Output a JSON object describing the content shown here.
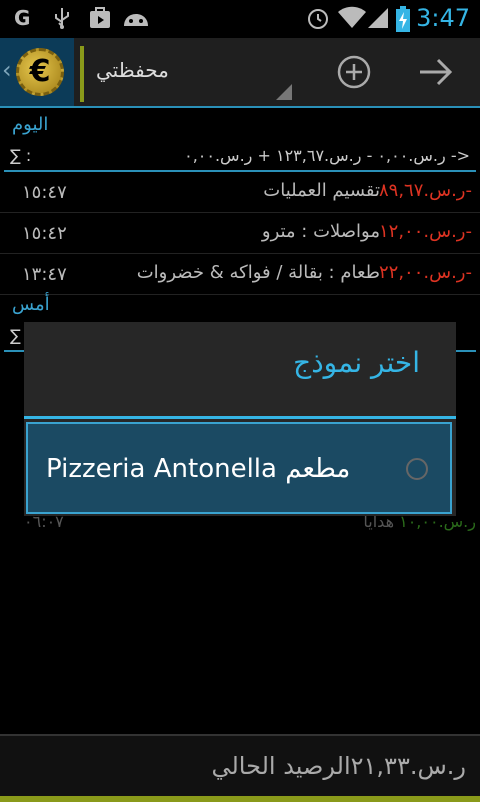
{
  "status_bar": {
    "time": "3:47",
    "icons": [
      "g-icon",
      "usb-icon",
      "play-store-icon",
      "android-icon",
      "alarm-icon",
      "wifi-icon",
      "signal-icon",
      "battery-charging-icon"
    ]
  },
  "action_bar": {
    "wallet_label": "محفظتي",
    "icons": [
      "euro-coin-icon",
      "add-icon",
      "arrow-right-icon"
    ]
  },
  "today": {
    "label": "اليوم",
    "sum_symbol": "∑ :",
    "sum_text": "<- ر.س.٠,٠٠     - ر.س.١٢٣,٦٧    + ر.س.٠,٠٠",
    "transactions": [
      {
        "amount": "-ر.س.٨٩,٦٧",
        "description": "تقسيم العمليات",
        "time": "١٥:٤٧"
      },
      {
        "amount": "-ر.س.١٢,٠٠",
        "description": "مواصلات : مترو",
        "time": "١٥:٤٢"
      },
      {
        "amount": "-ر.س.٢٢,٠٠",
        "description": "طعام : بقالة / فواكه & خضروات",
        "time": "١٣:٤٧"
      }
    ]
  },
  "yesterday": {
    "label": "أمس",
    "sum_symbol": "∑"
  },
  "dialog": {
    "title": "اختر نموذج",
    "option": "Pizzeria Antonella مطعم"
  },
  "below_dialog": {
    "time": "٠٦:٠٧",
    "amount": "ر.س.١٠,٠٠",
    "description": "هدايا"
  },
  "balance": {
    "text": "ر.س.٢١,٣٣الرصيد الحالي"
  },
  "colors": {
    "accent": "#35b5e5",
    "negative": "#d32f2f",
    "positive": "#3a9a2a",
    "olive": "#8a9a1a"
  }
}
